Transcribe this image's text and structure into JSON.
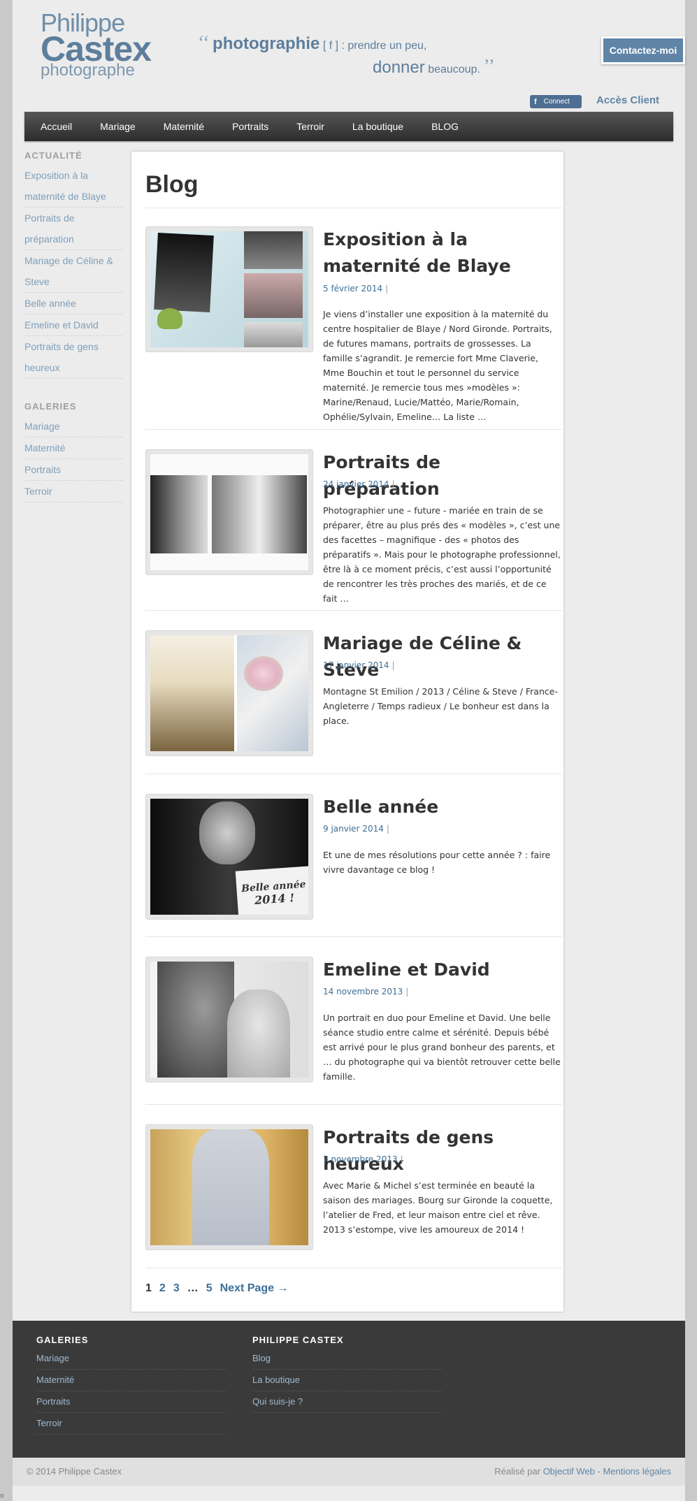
{
  "header": {
    "logo": {
      "line1": "Philippe",
      "line2": "Castex",
      "line3": "photographe"
    },
    "tagline": {
      "open_quote": "‘‘",
      "word1": "photographie",
      "rest1": "[ f ] : prendre un peu,",
      "word2": "donner",
      "rest2": "beaucoup.",
      "close_quote": "’’"
    },
    "contact_label": "Contactez-moi",
    "connect_label": "Connect",
    "connect_icon": "f",
    "acces_label": "Accès Client"
  },
  "nav": [
    "Accueil",
    "Mariage",
    "Maternité",
    "Portraits",
    "Terroir",
    "La boutique",
    "BLOG"
  ],
  "sidebar": {
    "actualite_title": "ACTUALITÉ",
    "actualite": [
      "Exposition à la",
      "maternité de Blaye",
      "Portraits de",
      "préparation",
      "Mariage de Céline &",
      "Steve",
      "Belle année",
      "Emeline et David",
      "Portraits de gens",
      "heureux"
    ],
    "galeries_title": "GALERIES",
    "galeries": [
      "Mariage",
      "Maternité",
      "Portraits",
      "Terroir"
    ]
  },
  "main": {
    "title": "Blog",
    "posts": [
      {
        "title": "Exposition à la maternité de Blaye",
        "date": "5 février 2014",
        "sep": "|",
        "excerpt": "Je viens d’installer une exposition à la maternité du centre hospitalier de Blaye / Nord Gironde. Portraits, de futures mamans, portraits de grossesses. La famille s’agrandit. Je remercie fort Mme Claverie, Mme Bouchin et tout le personnel du service maternité. Je remercie tous mes »modèles »: Marine/Renaud, Lucie/Mattéo, Marie/Romain, Ophélie/Sylvain, Emeline… La liste …"
      },
      {
        "title": "Portraits de préparation",
        "date": "24 janvier 2014",
        "sep": "|",
        "excerpt": "Photographier une – future - mariée en train de se préparer, être au plus prés des « modèles », c’est une des facettes – magnifique - des « photos des préparatifs ». Mais pour le photographe professionnel, être là à ce moment précis, c’est aussi l’opportunité de rencontrer les très proches des mariés, et de ce fait …"
      },
      {
        "title": "Mariage de Céline & Steve",
        "date": "17 janvier 2014",
        "sep": "|",
        "excerpt": "Montagne St Emilion / 2013 / Céline & Steve / France-Angleterre / Temps radieux / Le bonheur est dans la place."
      },
      {
        "title": "Belle année",
        "date": "9 janvier 2014",
        "sep": "|",
        "excerpt": "Et une de mes résolutions pour cette année ?  : faire vivre davantage ce blog !",
        "img_text1": "Belle année",
        "img_text2": "2014 !"
      },
      {
        "title": "Emeline et David",
        "date": "14 novembre 2013",
        "sep": "|",
        "excerpt": "Un portrait en duo pour Emeline et David. Une belle séance studio entre calme et sérénité. Depuis bébé est arrivé pour le plus grand bonheur des parents, et … du photographe qui va bientôt retrouver cette belle famille."
      },
      {
        "title": "Portraits de gens heureux",
        "date": "7 novembre 2013",
        "sep": "|",
        "excerpt": "Avec Marie & Michel s’est terminée en beauté la saison des mariages. Bourg sur Gironde la coquette, l’atelier de Fred, et leur maison entre ciel et rêve. 2013 s’estompe, vive les amoureux de 2014 !"
      }
    ],
    "pagination": {
      "current": "1",
      "p2": "2",
      "p3": "3",
      "ellipsis": "…",
      "p5": "5",
      "next": "Next Page →"
    }
  },
  "footer": {
    "col1_title": "GALERIES",
    "col1": [
      "Mariage",
      "Maternité",
      "Portraits",
      "Terroir"
    ],
    "col2_title": "PHILIPPE CASTEX",
    "col2": [
      "Blog",
      "La boutique",
      "Qui suis-je ?"
    ]
  },
  "bottom": {
    "copyright": "© 2014 Philippe Castex",
    "realise": "Réalisé par",
    "agency": "Objectif Web",
    "dash": " - ",
    "legal": "Mentions légales"
  },
  "corner_mark": "o"
}
